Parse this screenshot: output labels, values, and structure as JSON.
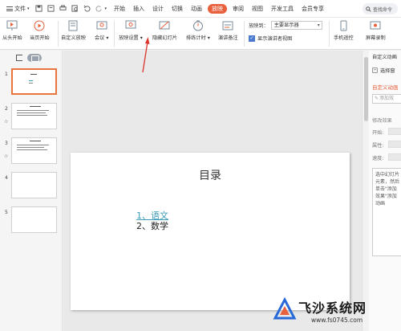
{
  "menubar": {
    "file_label": "文件",
    "tabs": [
      "开始",
      "插入",
      "设计",
      "切换",
      "动画",
      "放映",
      "审阅",
      "视图",
      "开发工具",
      "会员专享"
    ],
    "active_tab": "放映",
    "search_placeholder": "查找命令"
  },
  "ribbon": {
    "buttons": [
      "从头开始",
      "当页开始",
      "自定义放映",
      "会议",
      "放映设置",
      "隐藏幻灯片",
      "排练计时",
      "演讲备注",
      "手机遥控",
      "屏幕录制"
    ],
    "display_label": "放映到：",
    "display_value": "主要显示器",
    "presenter_view_label": "显示演讲者视图"
  },
  "thumbnails": {
    "numbers": [
      "1",
      "2",
      "3",
      "4",
      "5"
    ],
    "marks": [
      "",
      "☆",
      "☆",
      "",
      ""
    ]
  },
  "slide": {
    "title": "目录",
    "item1": "1、语文",
    "item2": "2、数学"
  },
  "rightpane": {
    "title": "自定义动画",
    "select_label": "选择窗",
    "subtitle": "自定义动画",
    "add_effect": "添加效",
    "modify_section": "修改效果",
    "start_label": "开始:",
    "property_label": "属性:",
    "speed_label": "速度:",
    "list_text": "选中幻灯片元素，然后单击\"添加效果\"添加动画"
  },
  "watermark": {
    "text": "飞沙系统网",
    "url": "www.fs0745.com"
  },
  "colors": {
    "accent": "#e8603c",
    "link": "#3c9bb7",
    "arrow": "#d9342b"
  }
}
